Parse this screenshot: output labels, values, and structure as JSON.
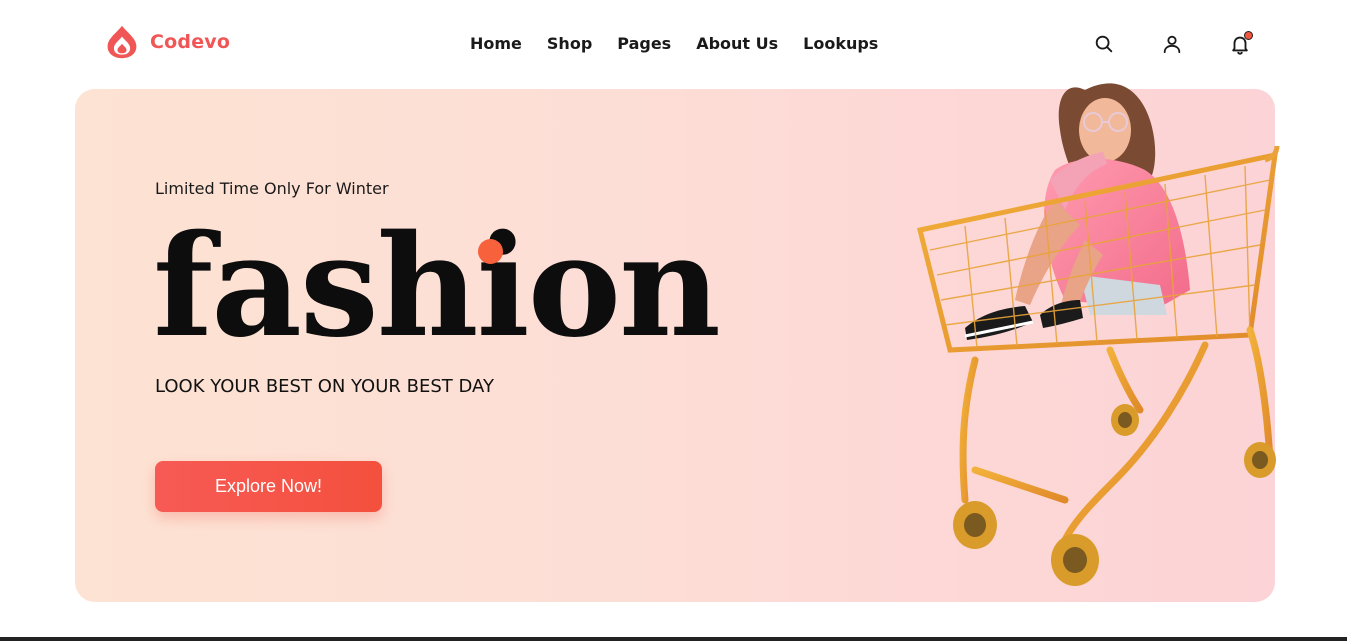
{
  "brand": {
    "name": "Codevo",
    "icon": "flame-drop-icon",
    "color": "#f05656"
  },
  "nav": {
    "items": [
      {
        "label": "Home"
      },
      {
        "label": "Shop"
      },
      {
        "label": "Pages"
      },
      {
        "label": "About Us"
      },
      {
        "label": "Lookups"
      }
    ]
  },
  "header_icons": [
    {
      "name": "search-icon"
    },
    {
      "name": "user-icon"
    },
    {
      "name": "bell-icon",
      "has_notification": true
    }
  ],
  "hero": {
    "kicker": "Limited Time Only For Winter",
    "title": "fashion",
    "tagline": "LOOK YOUR BEST ON YOUR BEST DAY",
    "cta_label": "Explore Now!",
    "accent_color": "#f7623c",
    "illustration": "woman-sitting-in-shopping-cart"
  }
}
